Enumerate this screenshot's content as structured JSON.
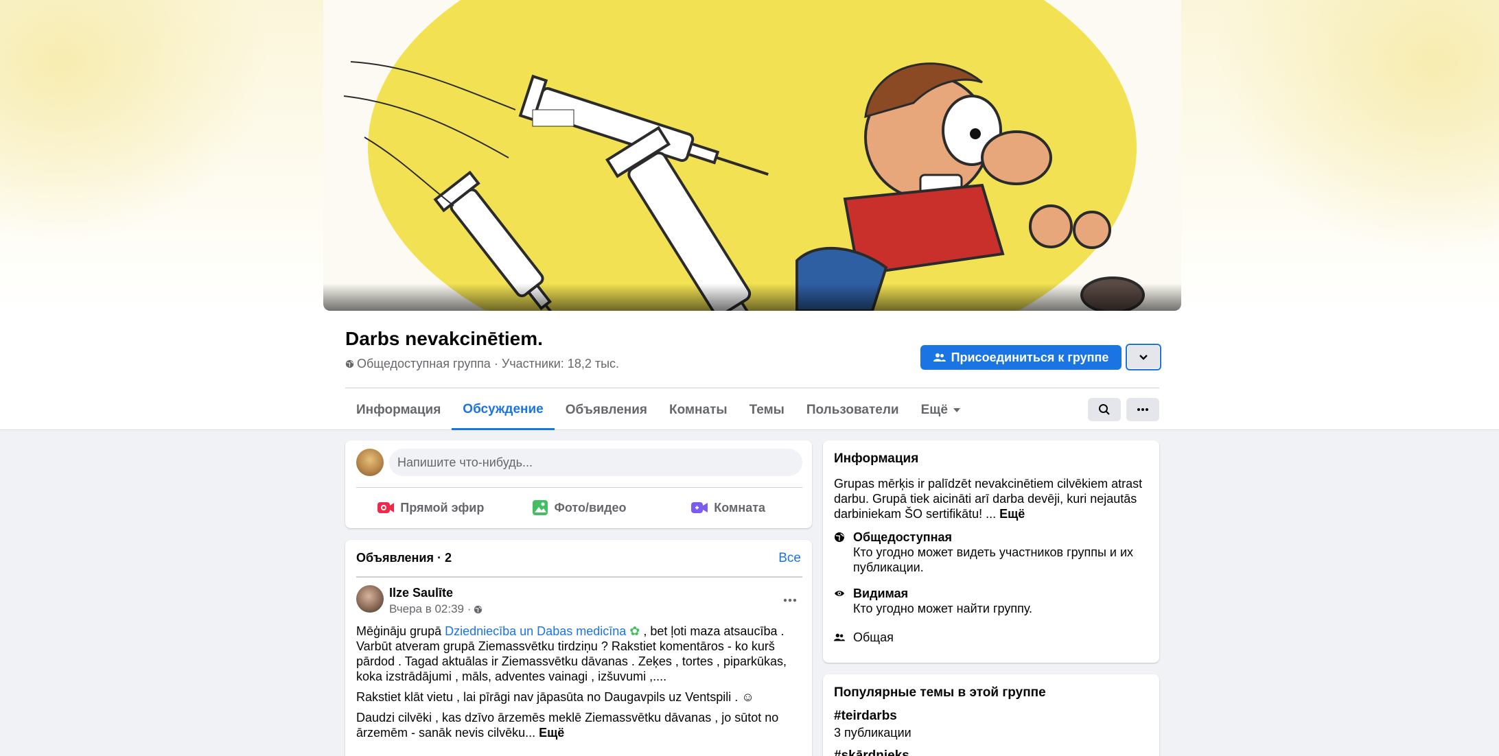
{
  "group": {
    "name": "Darbs nevakcinētiem.",
    "meta": "Общедоступная группа · Участники: 18,2 тыс.",
    "join_label": "Присоединиться к группе"
  },
  "tabs": [
    {
      "label": "Информация"
    },
    {
      "label": "Обсуждение"
    },
    {
      "label": "Объявления"
    },
    {
      "label": "Комнаты"
    },
    {
      "label": "Темы"
    },
    {
      "label": "Пользователи"
    },
    {
      "label": "Ещё"
    }
  ],
  "composer": {
    "placeholder": "Напишите что-нибудь...",
    "live_label": "Прямой эфир",
    "photo_label": "Фото/видео",
    "room_label": "Комната"
  },
  "announcements": {
    "header": "Объявления · 2",
    "all_label": "Все",
    "post": {
      "author": "Ilze Saulīte",
      "time": "Вчера в 02:39 ·",
      "p1_before": "Mēģināju grupā ",
      "p1_link": "Dziedniecība un Dabas medicīna",
      "p1_after": " , bet ļoti maza atsaucība . Varbūt atveram  grupā Ziemassvētku tirdziņu ? Rakstiet komentāros - ko kurš pārdod . Tagad aktuālas ir Ziemassvētku dāvanas . Zeķes , tortes , piparkūkas, koka izstrādājumi , māls,  adventes vainagi , izšuvumi ,....",
      "p2": "Rakstiet klāt vietu , lai  pīrāgi nav jāpasūta no Daugavpils uz Ventspili .",
      "p3": "Daudzi cilvēki , kas dzīvo ārzemēs meklē Ziemassvētku dāvanas , jo sūtot no ārzemēm - sanāk nevis cilvēku...",
      "more_label": "Ещё"
    }
  },
  "info": {
    "title": "Информация",
    "description": "Grupas mērķis ir palīdzēt nevakcinētiem cilvēkiem atrast darbu. Grupā tiek aicināti arī darba devēji, kuri nejautās darbiniekam ŠO sertifikātu! ...",
    "more_label": "Ещё",
    "public_title": "Общедоступная",
    "public_desc": "Кто угодно может видеть участников группы и их публикации.",
    "visible_title": "Видимая",
    "visible_desc": "Кто угодно может найти группу.",
    "general_title": "Общая"
  },
  "topics": {
    "title": "Популярные темы в этой группе",
    "items": [
      {
        "tag": "#teirdarbs",
        "count": "3 публикации"
      },
      {
        "tag": "#skārdnieks",
        "count": ""
      }
    ]
  },
  "colors": {
    "accent": "#1b74e4",
    "background": "#f0f2f5",
    "live_icon": "#f02849",
    "photo_icon": "#45bd62",
    "room_icon": "#7c5cf0"
  },
  "icons": [
    "globe-icon",
    "people-icon",
    "chevron-down-icon",
    "search-icon",
    "more-icon",
    "live-video-icon",
    "photo-icon",
    "room-icon",
    "eye-icon",
    "seedling-emoji",
    "smile-emoji"
  ]
}
